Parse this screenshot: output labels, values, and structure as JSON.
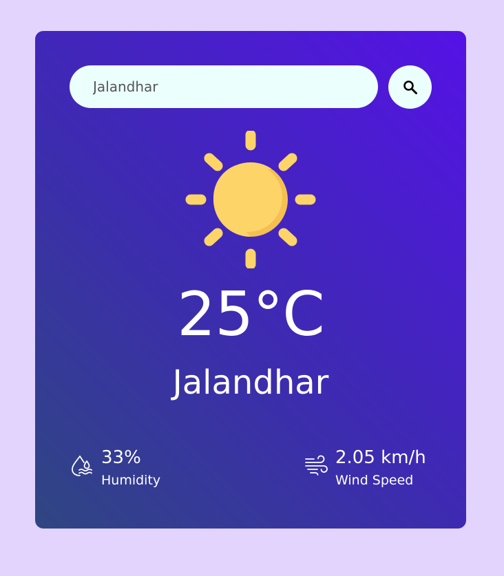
{
  "search": {
    "value": "Jalandhar",
    "button_icon": "search-icon"
  },
  "weather": {
    "icon": "sun-icon",
    "temperature": "25°C",
    "city": "Jalandhar"
  },
  "details": {
    "humidity": {
      "icon": "humidity-icon",
      "value": "33%",
      "label": "Humidity"
    },
    "wind": {
      "icon": "wind-icon",
      "value": "2.05 km/h",
      "label": "Wind Speed"
    }
  },
  "colors": {
    "page_background": "#e2d4fd",
    "card_gradient_start": "#2f4682",
    "card_gradient_end": "#5512e6",
    "input_background": "#ebfffc",
    "sun": "#fcd467",
    "sun_shade": "#f5bf52"
  }
}
